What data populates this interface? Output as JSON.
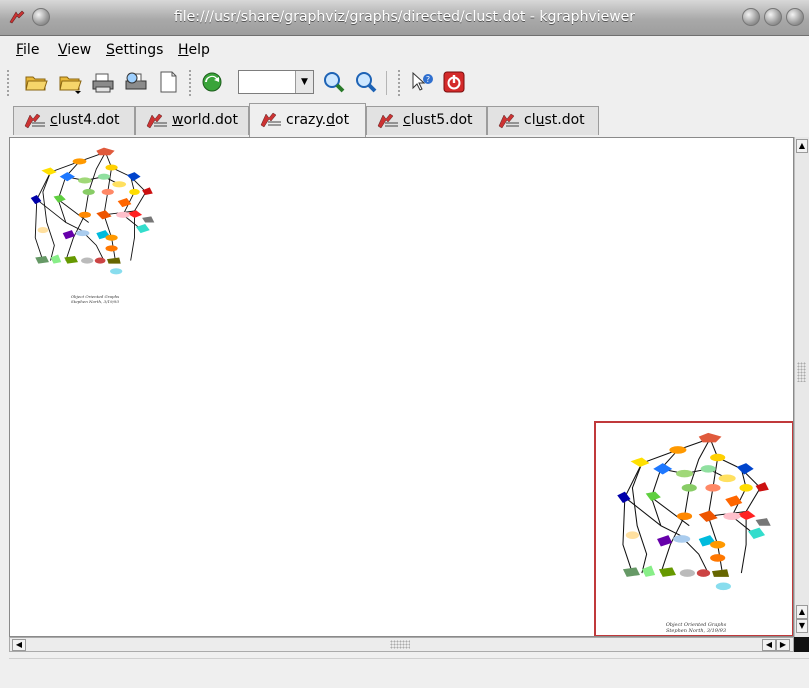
{
  "window": {
    "title": "file:///usr/share/graphviz/graphs/directed/clust.dot - kgraphviewer"
  },
  "menubar": {
    "items": [
      {
        "label": "File",
        "mnemonic": "F"
      },
      {
        "label": "View",
        "mnemonic": "V"
      },
      {
        "label": "Settings",
        "mnemonic": "S"
      },
      {
        "label": "Help",
        "mnemonic": "H"
      }
    ]
  },
  "toolbar": {
    "buttons": [
      "open-icon",
      "open-recent-icon",
      "print-icon",
      "print-preview-icon",
      "new-page-icon",
      "reload-icon",
      "zoom-in-icon",
      "zoom-out-icon",
      "whats-this-icon",
      "quit-icon"
    ],
    "zoom_value": ""
  },
  "tabs": [
    {
      "label": "clust4.dot",
      "mnemonic_index": 0,
      "active": false
    },
    {
      "label": "world.dot",
      "mnemonic_index": 0,
      "active": false
    },
    {
      "label": "crazy.dot",
      "mnemonic_index": 6,
      "active": true
    },
    {
      "label": "clust5.dot",
      "mnemonic_index": 0,
      "active": false
    },
    {
      "label": "clust.dot",
      "mnemonic_index": 2,
      "active": false
    }
  ],
  "graph": {
    "caption_line1": "Object Oriented Graphs",
    "caption_line2": "Stephen North, 3/19/93",
    "birdseye_caption_line1": "Object Oriented Graphs",
    "birdseye_caption_line2": "Stephen North, 3/19/93"
  },
  "colors": {
    "birdseye_border": "#c0393b",
    "titlebar_text": "#ffffff"
  }
}
